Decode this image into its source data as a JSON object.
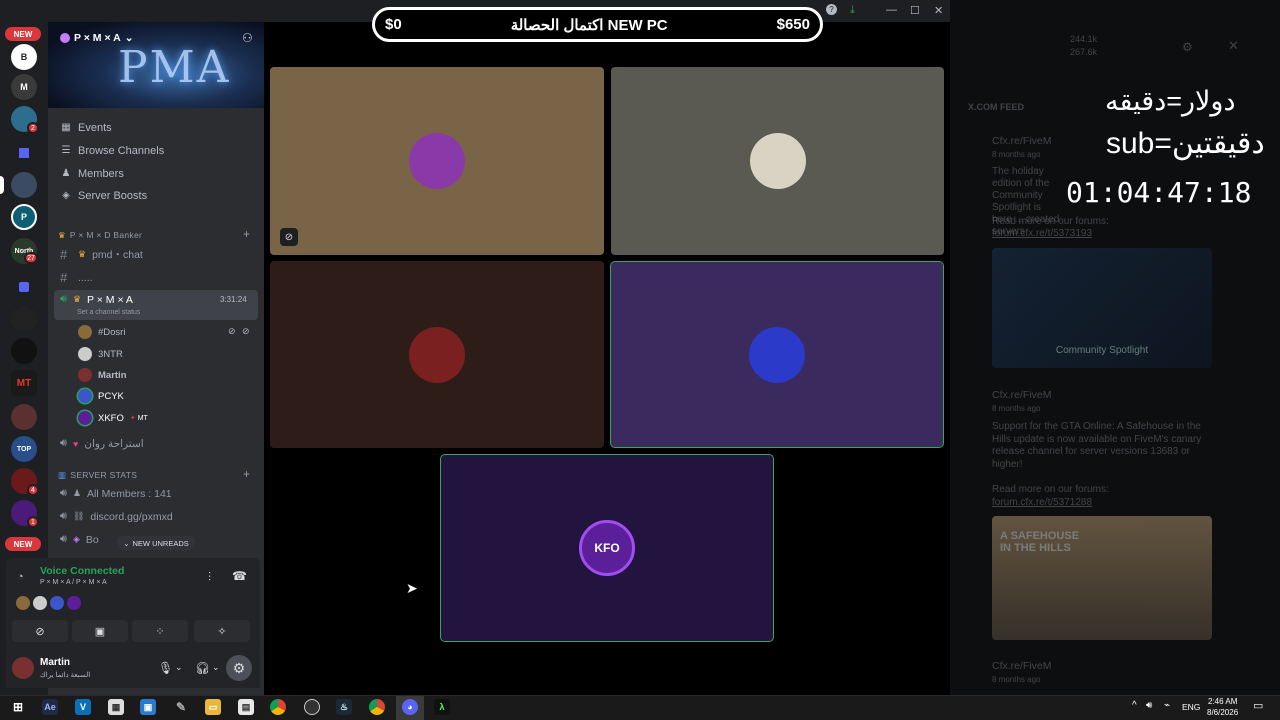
{
  "window": {
    "back": "←",
    "forward": "→",
    "minimize": "—",
    "maximize": "☐",
    "close": "✕"
  },
  "goal_bar": {
    "left": "$0",
    "center": "اكتمال الحصالة NEW PC",
    "right": "$650"
  },
  "overlay": {
    "line1": "دولار=دقيقه",
    "line2": "sub=دقيقتين",
    "timer": "01:04:47:18"
  },
  "rail": {
    "new_top": "NEW",
    "new_bottom": "NEW",
    "badges": [
      "2",
      "27",
      "4",
      "1"
    ],
    "north_label": "North",
    "badge_north": "27"
  },
  "server": {
    "name": "P × M × A",
    "chevron": "⌄"
  },
  "nav": [
    {
      "label": "Events",
      "icon": "calendar-icon"
    },
    {
      "label": "Browse Channels",
      "icon": "browse-icon"
    },
    {
      "label": "Members",
      "icon": "members-icon"
    },
    {
      "label": "Server Boosts",
      "icon": "boost-icon"
    }
  ],
  "category1": "P × M × D Banker",
  "channels": [
    {
      "name": "pmd・chat"
    },
    {
      "name": "....."
    }
  ],
  "voice_channel": {
    "name": "P × M × A",
    "time": "3:31:24",
    "status": "Set a channel status"
  },
  "voice_users": [
    {
      "name": "#Dosri"
    },
    {
      "name": "3NTR"
    },
    {
      "name": "Martin"
    },
    {
      "name": "PCYK"
    },
    {
      "name": "XKFO",
      "tag": "MT"
    }
  ],
  "other_voice": "استراحة روان",
  "category2": "SERVER STATS",
  "stats": [
    {
      "name": "All Members : 141"
    },
    {
      "name": "discord.gg/pxmxd"
    },
    {
      "name": "Bo"
    }
  ],
  "new_unreads": "NEW UNREADS",
  "voice_panel": {
    "status": "Voice Connected",
    "channel": "P × M × A / P × M × A"
  },
  "user_panel": {
    "name": "Martin",
    "status": "السبعة دائما يراك"
  },
  "right_panel": {
    "stat1": "244.1k",
    "stat2": "267.6k",
    "feed_title": "X.COM FEED",
    "post1_author": "Cfx.re/FiveM",
    "post1_time": "8 months ago",
    "post1_text": "The holiday edition of the Community Spotlight is here ... created servers",
    "post1_link_label": "Read more on our forums:",
    "post1_link": "forum.cfx.re/t/5373193",
    "post1_img_caption": "Community Spotlight",
    "post2_author": "Cfx.re/FiveM",
    "post2_time": "8 months ago",
    "post2_text": "Support for the GTA Online: A Safehouse in the Hills update is now available on FiveM's canary release channel for server versions 13683 or higher!",
    "post2_link_label": "Read more on our forums:",
    "post2_link": "forum.cfx.re/t/5371288",
    "post2_img_caption": "A SAFEHOUSE IN THE HILLS",
    "post3_author": "Cfx.re/FiveM",
    "post3_time": "8 months ago"
  },
  "taskbar": {
    "lang": "ENG",
    "time": "2:46 AM",
    "date": "8/6/2026"
  },
  "colors": {
    "discord_bg": "#2b2d31",
    "rail_bg": "#1e1f22",
    "speaking": "#3ba55c",
    "badge_red": "#da373c",
    "voice_green": "#23a55a"
  }
}
